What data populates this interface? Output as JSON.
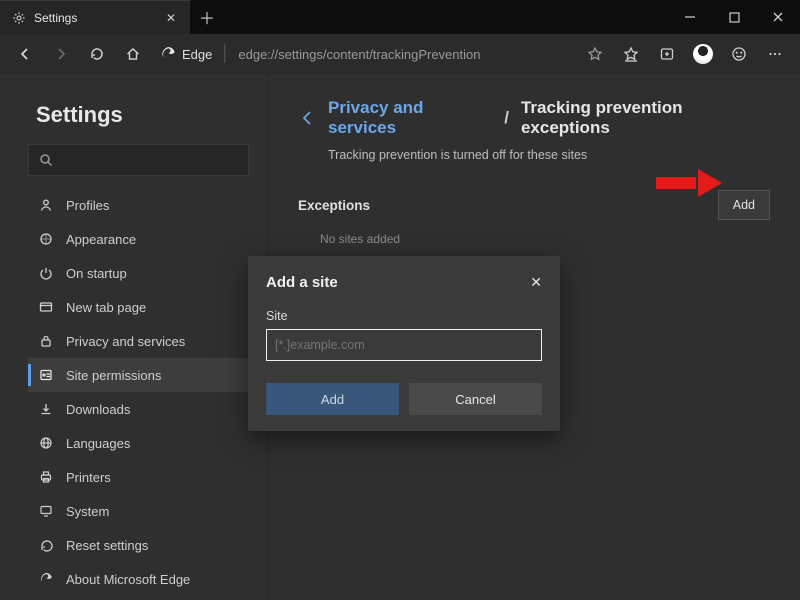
{
  "window": {
    "tab_title": "Settings",
    "address_label": "Edge",
    "url": "edge://settings/content/trackingPrevention"
  },
  "sidebar": {
    "heading": "Settings",
    "search_placeholder": "",
    "items": [
      {
        "label": "Profiles"
      },
      {
        "label": "Appearance"
      },
      {
        "label": "On startup"
      },
      {
        "label": "New tab page"
      },
      {
        "label": "Privacy and services"
      },
      {
        "label": "Site permissions"
      },
      {
        "label": "Downloads"
      },
      {
        "label": "Languages"
      },
      {
        "label": "Printers"
      },
      {
        "label": "System"
      },
      {
        "label": "Reset settings"
      },
      {
        "label": "About Microsoft Edge"
      }
    ],
    "selected_index": 5
  },
  "main": {
    "breadcrumb_parent": "Privacy and services",
    "breadcrumb_sep": "/",
    "breadcrumb_current": "Tracking prevention exceptions",
    "subtext": "Tracking prevention is turned off for these sites",
    "exceptions_label": "Exceptions",
    "add_button": "Add",
    "empty_text": "No sites added"
  },
  "modal": {
    "title": "Add a site",
    "field_label": "Site",
    "placeholder": "[*.]example.com",
    "value": "",
    "add": "Add",
    "cancel": "Cancel"
  }
}
